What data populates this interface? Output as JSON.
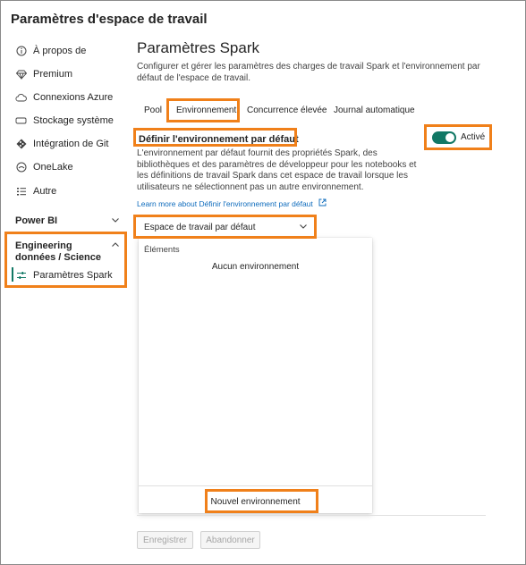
{
  "window": {
    "title": "Paramètres d'espace de travail"
  },
  "sidebar": {
    "items": [
      {
        "label": "À propos de",
        "icon": "info-icon"
      },
      {
        "label": "Premium",
        "icon": "diamond-icon"
      },
      {
        "label": "Connexions Azure",
        "icon": "cloud-icon"
      },
      {
        "label": "Stockage système",
        "icon": "storage-icon"
      },
      {
        "label": "Intégration de Git",
        "icon": "git-icon"
      },
      {
        "label": "OneLake",
        "icon": "onelake-icon"
      },
      {
        "label": "Autre",
        "icon": "list-icon"
      }
    ],
    "power_bi": {
      "label": "Power BI"
    },
    "engineering": {
      "label": "Engineering données / Science",
      "items": [
        {
          "label": "Paramètres Spark",
          "icon": "sliders-icon"
        }
      ]
    }
  },
  "main": {
    "title": "Paramètres Spark",
    "description": "Configurer et gérer les paramètres des charges de travail Spark et l'environnement par défaut de l'espace de travail.",
    "tabs": [
      {
        "label": "Pool"
      },
      {
        "label": "Environnement"
      },
      {
        "label": "Concurrence élevée"
      },
      {
        "label": "Journal automatique"
      }
    ],
    "section": {
      "title": "Définir l'environnement par défaut",
      "description": "L'environnement par défaut fournit des propriétés Spark, des bibliothèques et des paramètres de développeur pour les notebooks et les définitions de travail Spark dans cet espace de travail lorsque les utilisateurs ne sélectionnent pas un autre environnement.",
      "learn_more": "Learn more about Définir l'environnement par défaut",
      "toggle_label": "Activé",
      "toggle_on": true
    },
    "dropdown": {
      "value": "Espace de travail par défaut"
    },
    "popup": {
      "header": "Éléments",
      "empty": "Aucun environnement",
      "new_button": "Nouvel environnement"
    },
    "buttons": {
      "save": "Enregistrer",
      "discard": "Abandonner"
    }
  },
  "colors": {
    "accent": "#117865",
    "highlight": "#f0801a",
    "link": "#0f6cbd"
  }
}
